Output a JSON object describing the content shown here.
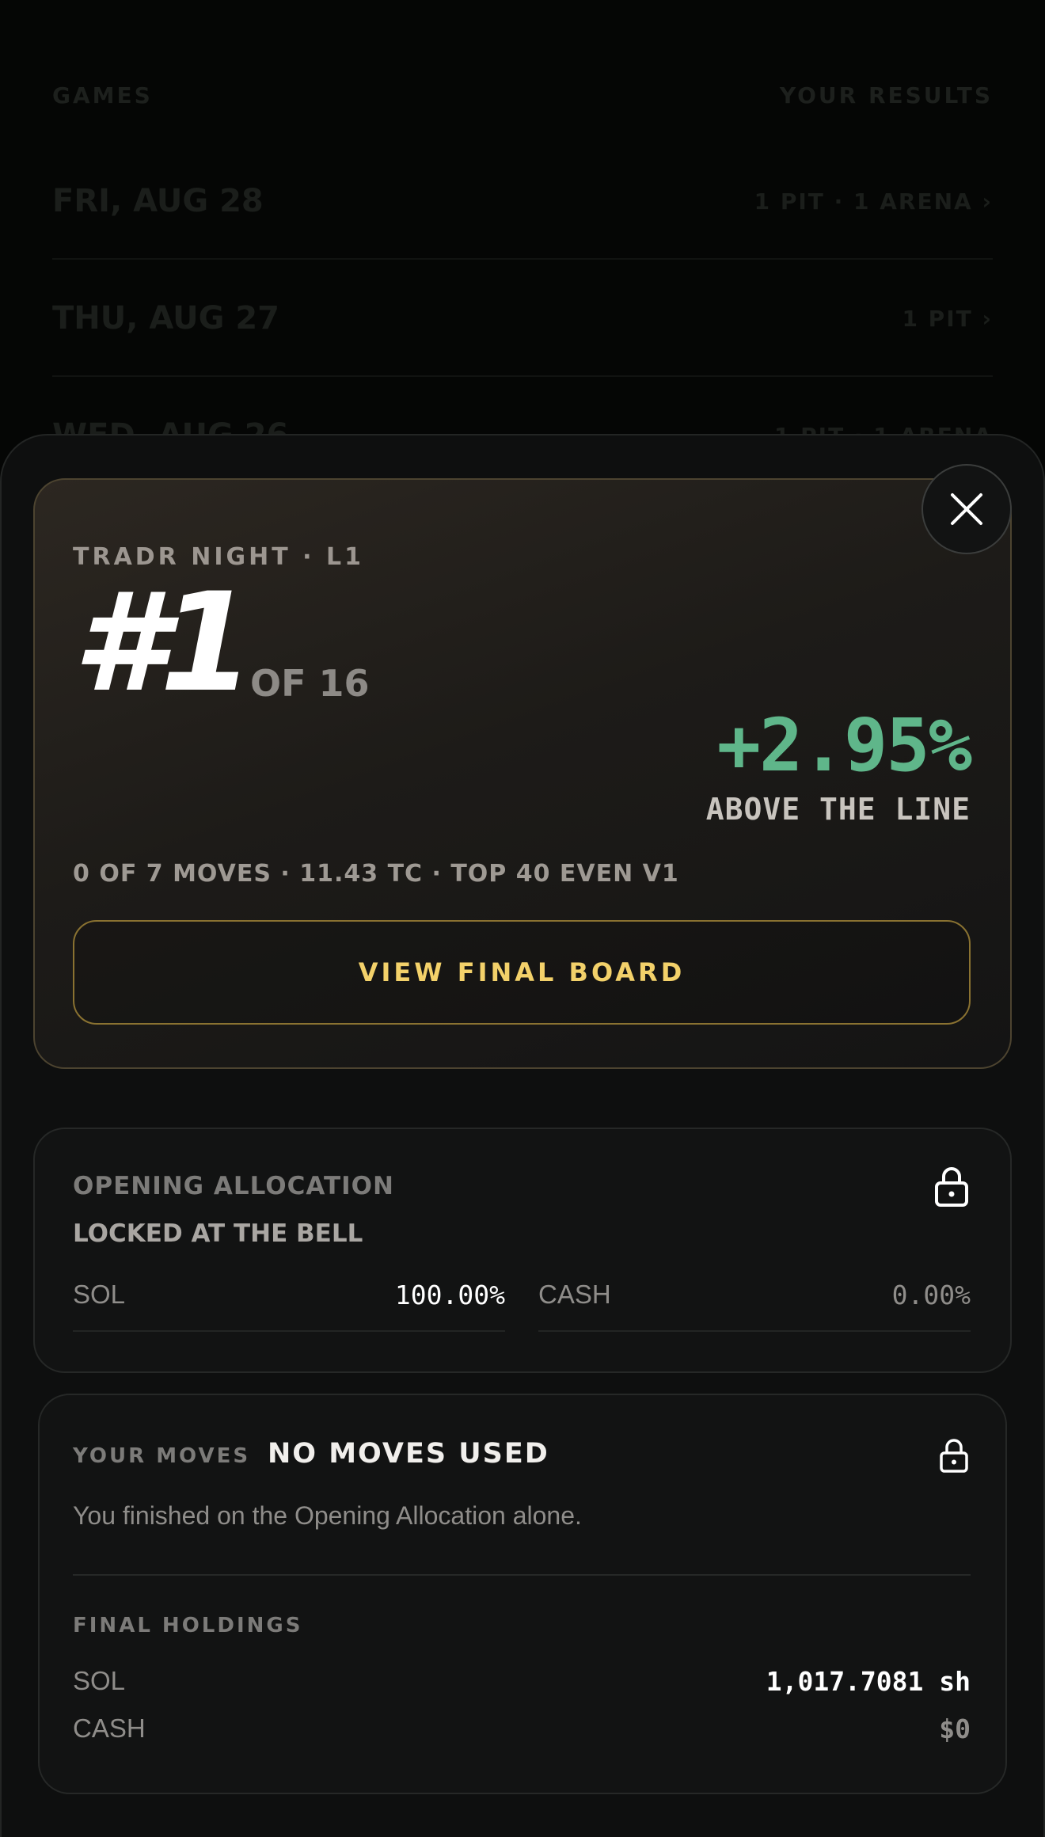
{
  "background": {
    "header_left": "GAMES",
    "header_right": "YOUR RESULTS",
    "rows": [
      {
        "date": "FRI, AUG 28",
        "meta": "1 PIT · 1 ARENA ›"
      },
      {
        "date": "THU, AUG 27",
        "meta": "1 PIT ›"
      },
      {
        "date": "WED, AUG 26",
        "meta": "1 PIT · 1 ARENA"
      }
    ]
  },
  "result": {
    "event": "TRADR NIGHT · L1",
    "rank": "#1",
    "of_total": "OF 16",
    "percent": "+2.95%",
    "percent_caption": "ABOVE THE LINE",
    "summary": "0 OF 7 MOVES · 11.43 TC · TOP 40 EVEN V1",
    "button_label": "VIEW FINAL BOARD"
  },
  "allocation": {
    "title": "OPENING ALLOCATION",
    "subtitle": "LOCKED AT THE BELL",
    "items": [
      {
        "label": "SOL",
        "value": "100.00%"
      },
      {
        "label": "CASH",
        "value": "0.00%"
      }
    ]
  },
  "moves": {
    "label": "YOUR MOVES",
    "status": "NO MOVES USED",
    "description": "You finished on the Opening Allocation alone.",
    "holdings_title": "FINAL HOLDINGS",
    "holdings": [
      {
        "label": "SOL",
        "value": "1,017.7081 sh"
      },
      {
        "label": "CASH",
        "value": "$0"
      }
    ]
  },
  "icons": {
    "close": "close-icon",
    "lock": "lock-icon"
  },
  "colors": {
    "positive": "#5fb68a",
    "accent_gold": "#f3d16a",
    "border_gold": "#8a7231"
  }
}
